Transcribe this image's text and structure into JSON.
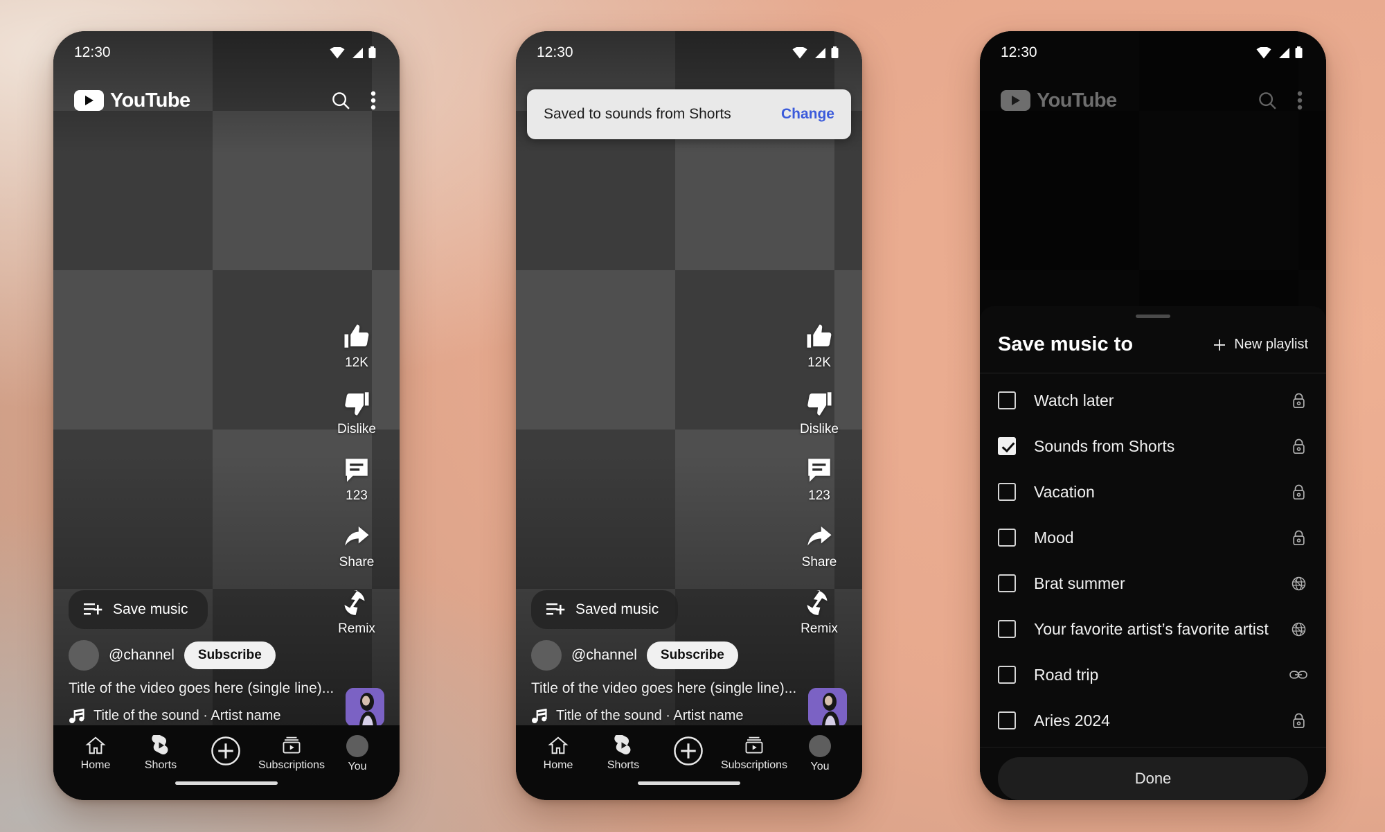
{
  "background": {
    "accent_peach": "#e7a98e",
    "accent_cream": "#f0e3d8",
    "accent_gray": "#b9b4b0"
  },
  "status_bar": {
    "time": "12:30",
    "icons": [
      "wifi-icon",
      "cellular-signal-icon",
      "battery-icon"
    ]
  },
  "app_bar": {
    "logo_text": "YouTube",
    "search_icon": "search-icon",
    "more_icon": "more-vertical-icon"
  },
  "rail": [
    {
      "icon": "thumbs-up-icon",
      "label": "12K"
    },
    {
      "icon": "thumbs-down-icon",
      "label": "Dislike"
    },
    {
      "icon": "comment-icon",
      "label": "123"
    },
    {
      "icon": "share-icon",
      "label": "Share"
    },
    {
      "icon": "remix-icon",
      "label": "Remix"
    }
  ],
  "meta": {
    "save_chip_default": "Save music",
    "save_chip_saved": "Saved music",
    "save_chip_icon": "playlist-add-icon",
    "channel": "@channel",
    "subscribe": "Subscribe",
    "video_title": "Title of the video goes here (single line)...",
    "sound": "Title of the sound · Artist name",
    "sound_icon": "music-note-icon"
  },
  "bottom_nav": [
    {
      "icon": "home-icon",
      "label": "Home"
    },
    {
      "icon": "shorts-icon",
      "label": "Shorts"
    },
    {
      "icon": "create-plus-icon",
      "label": ""
    },
    {
      "icon": "subscriptions-icon",
      "label": "Subscriptions"
    },
    {
      "icon": "account-avatar-icon",
      "label": "You"
    }
  ],
  "snackbar": {
    "message": "Saved to sounds from Shorts",
    "action": "Change",
    "action_color": "#3b5bdb"
  },
  "sheet": {
    "title": "Save music to",
    "new_playlist": "New playlist",
    "new_playlist_icon": "plus-icon",
    "done": "Done",
    "playlists": [
      {
        "name": "Watch later",
        "checked": false,
        "privacy": "lock-icon"
      },
      {
        "name": "Sounds from Shorts",
        "checked": true,
        "privacy": "lock-icon"
      },
      {
        "name": "Vacation",
        "checked": false,
        "privacy": "lock-icon"
      },
      {
        "name": "Mood",
        "checked": false,
        "privacy": "lock-icon"
      },
      {
        "name": "Brat summer",
        "checked": false,
        "privacy": "globe-icon"
      },
      {
        "name": "Your favorite artist’s favorite artist",
        "checked": false,
        "privacy": "globe-icon"
      },
      {
        "name": "Road trip",
        "checked": false,
        "privacy": "link-icon"
      },
      {
        "name": "Aries 2024",
        "checked": false,
        "privacy": "lock-icon"
      }
    ]
  }
}
